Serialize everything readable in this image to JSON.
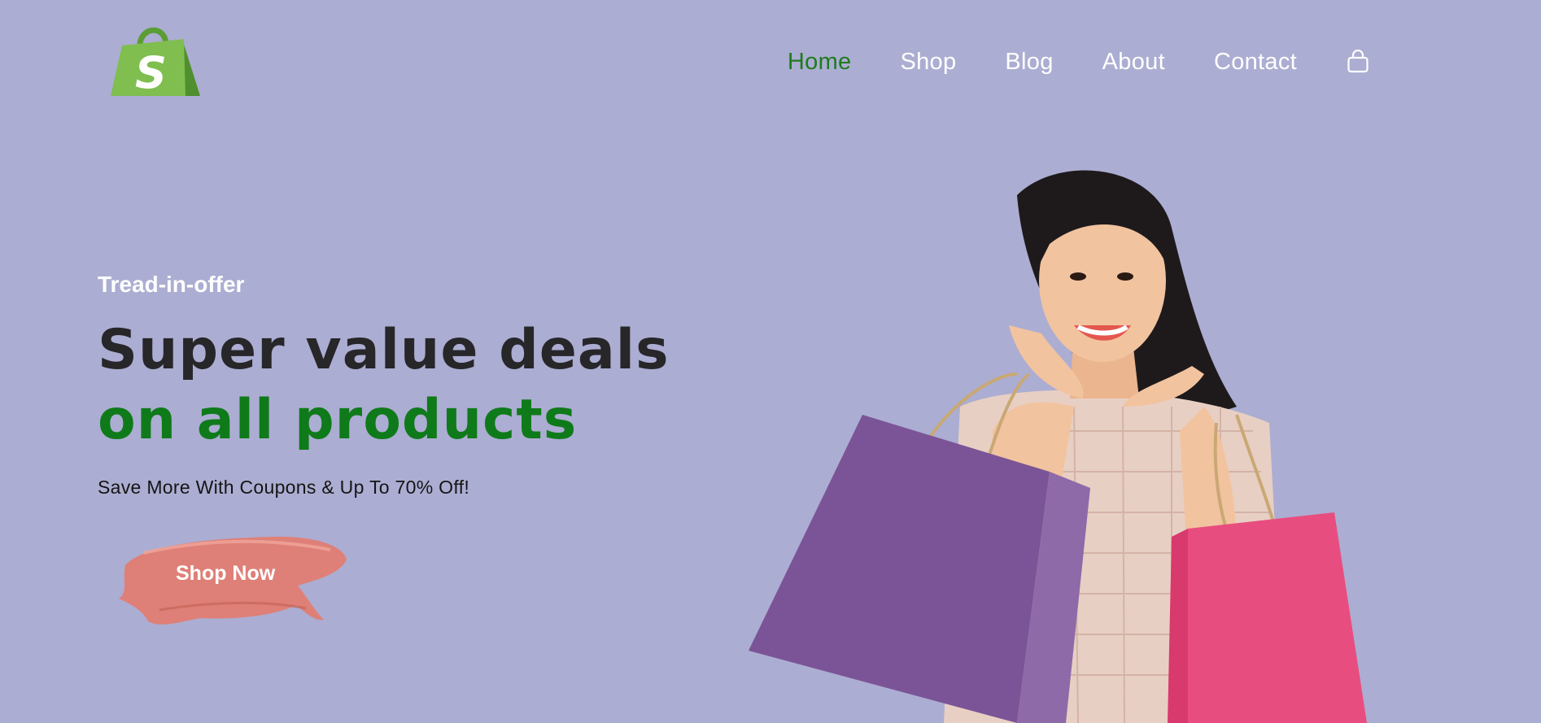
{
  "header": {
    "logo_icon": "shopping-bag-logo",
    "nav": [
      {
        "label": "Home",
        "active": true
      },
      {
        "label": "Shop",
        "active": false
      },
      {
        "label": "Blog",
        "active": false
      },
      {
        "label": "About",
        "active": false
      },
      {
        "label": "Contact",
        "active": false
      }
    ],
    "cart_icon": "shopping-bag-icon"
  },
  "hero": {
    "tagline": "Tread-in-offer",
    "headline_line1": "Super value deals",
    "headline_line2": "on all products",
    "subtext": "Save More With Coupons & Up To 70% Off!",
    "cta_label": "Shop Now",
    "image_icon": "woman-with-shopping-bags-image"
  },
  "colors": {
    "background": "#acadd2",
    "accent_green": "#0f7a1a",
    "nav_active": "#1e7b1e",
    "headline_dark": "#272629",
    "brush": "#e07d72"
  }
}
